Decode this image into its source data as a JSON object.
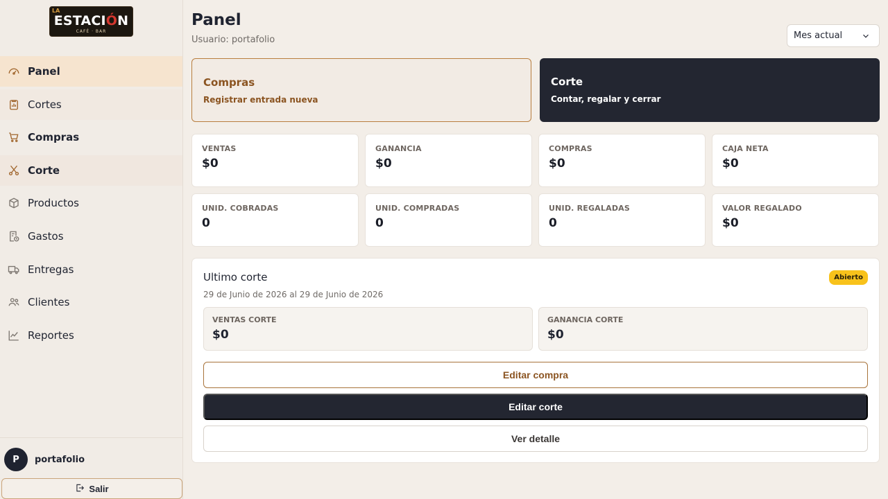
{
  "brand": {
    "logo_small": "LA",
    "logo_main_a": "ESTACI",
    "logo_main_o": "Ó",
    "logo_main_b": "N",
    "logo_sub": "CAFÉ · BAR"
  },
  "sidebar": {
    "items": [
      {
        "label": "Panel",
        "icon": "dashboard-icon"
      },
      {
        "label": "Cortes",
        "icon": "clipboard-chart-icon"
      },
      {
        "label": "Compras",
        "icon": "cart-icon"
      },
      {
        "label": "Corte",
        "icon": "scissors-icon"
      },
      {
        "label": "Productos",
        "icon": "box-icon"
      },
      {
        "label": "Gastos",
        "icon": "receipt-clock-icon"
      },
      {
        "label": "Entregas",
        "icon": "truck-icon"
      },
      {
        "label": "Clientes",
        "icon": "users-icon"
      },
      {
        "label": "Reportes",
        "icon": "trend-chart-icon"
      }
    ],
    "user": {
      "initial": "P",
      "name": "portafolio"
    },
    "logout_label": "Salir"
  },
  "header": {
    "title": "Panel",
    "subtitle": "Usuario: portafolio",
    "period": "Mes actual"
  },
  "actions": {
    "compras": {
      "title": "Compras",
      "subtitle": "Registrar entrada nueva"
    },
    "corte": {
      "title": "Corte",
      "subtitle": "Contar, regalar y cerrar"
    }
  },
  "stats": [
    {
      "label": "VENTAS",
      "value": "$0"
    },
    {
      "label": "GANANCIA",
      "value": "$0"
    },
    {
      "label": "COMPRAS",
      "value": "$0"
    },
    {
      "label": "CAJA NETA",
      "value": "$0"
    },
    {
      "label": "UNID. COBRADAS",
      "value": "0"
    },
    {
      "label": "UNID. COMPRADAS",
      "value": "0"
    },
    {
      "label": "UNID. REGALADAS",
      "value": "0"
    },
    {
      "label": "VALOR REGALADO",
      "value": "$0"
    }
  ],
  "last_cut": {
    "title": "Ultimo corte",
    "range": "29 de Junio de 2026 al 29 de Junio de 2026",
    "badge": "Abierto",
    "ventas_label": "VENTAS CORTE",
    "ventas_value": "$0",
    "ganancia_label": "GANANCIA CORTE",
    "ganancia_value": "$0",
    "btn_edit_compra": "Editar compra",
    "btn_edit_corte": "Editar corte",
    "btn_detalle": "Ver detalle"
  },
  "colors": {
    "accent": "#a0652c",
    "dark": "#232631",
    "badge": "#f8c21b"
  }
}
